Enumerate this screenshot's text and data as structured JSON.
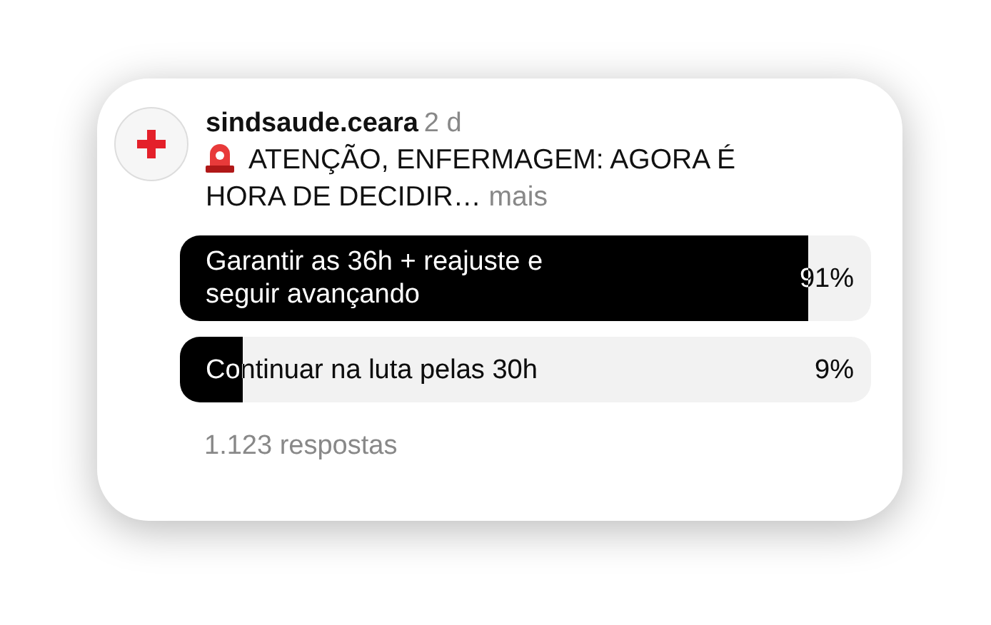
{
  "post": {
    "username": "sindsaude.ceara",
    "time": "2 d",
    "caption_lines": [
      "ATENÇÃO, ENFERMAGEM: AGORA É",
      "HORA DE DECIDIR…"
    ],
    "more": "mais"
  },
  "poll": {
    "options": [
      {
        "label": "Garantir as 36h + reajuste e seguir avançando",
        "percent": "91%",
        "level": 0.91
      },
      {
        "label": "Continuar na luta pelas 30h",
        "percent": "9%",
        "level": 0.09
      }
    ],
    "responses": "1.123 respostas"
  }
}
